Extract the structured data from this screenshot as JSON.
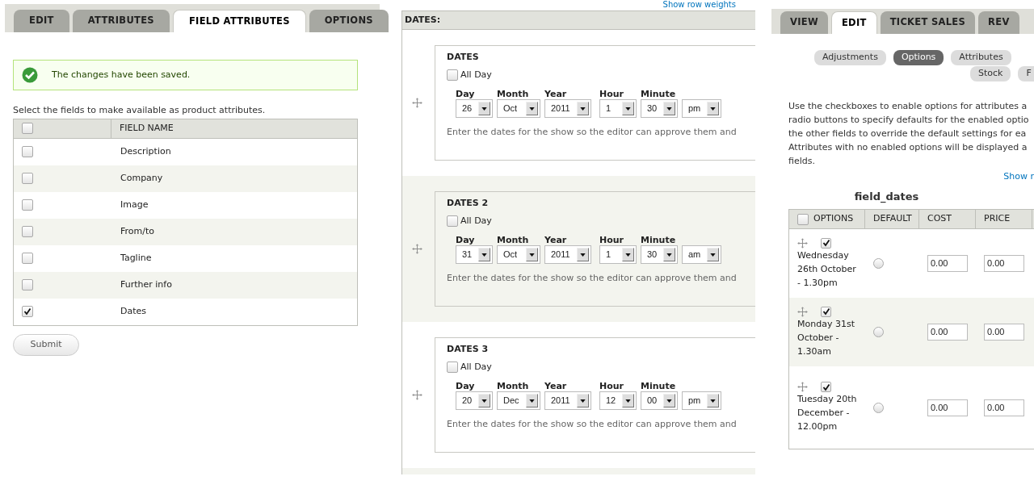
{
  "left": {
    "tabs": [
      {
        "label": "EDIT",
        "selected": false
      },
      {
        "label": "ATTRIBUTES",
        "selected": false
      },
      {
        "label": "FIELD ATTRIBUTES",
        "selected": true
      },
      {
        "label": "OPTIONS",
        "selected": false
      }
    ],
    "message": "The changes have been saved.",
    "intro": "Select the fields to make available as product attributes.",
    "table": {
      "select_all_checked": false,
      "column": "FIELD NAME",
      "rows": [
        {
          "label": "Description",
          "checked": false
        },
        {
          "label": "Company",
          "checked": false
        },
        {
          "label": "Image",
          "checked": false
        },
        {
          "label": "From/to",
          "checked": false
        },
        {
          "label": "Tagline",
          "checked": false
        },
        {
          "label": "Further info",
          "checked": false
        },
        {
          "label": "Dates",
          "checked": true
        }
      ]
    },
    "submit": "Submit"
  },
  "middle": {
    "top_link": "Show row weights",
    "heading": "DATES:",
    "groups": [
      {
        "title": "DATES",
        "all_day_label": "All Day",
        "all_day": false,
        "date_fields": [
          {
            "label": "Day",
            "value": "26"
          },
          {
            "label": "Month",
            "value": "Oct"
          },
          {
            "label": "Year",
            "value": "2011"
          }
        ],
        "time_fields": [
          {
            "label": "Hour",
            "value": "1"
          },
          {
            "label": "Minute",
            "value": "30"
          },
          {
            "value": "pm"
          }
        ],
        "description": "Enter the dates for the show so the editor can approve them and"
      },
      {
        "title": "DATES 2",
        "all_day_label": "All Day",
        "all_day": false,
        "date_fields": [
          {
            "label": "Day",
            "value": "31"
          },
          {
            "label": "Month",
            "value": "Oct"
          },
          {
            "label": "Year",
            "value": "2011"
          }
        ],
        "time_fields": [
          {
            "label": "Hour",
            "value": "1"
          },
          {
            "label": "Minute",
            "value": "30"
          },
          {
            "value": "am"
          }
        ],
        "description": "Enter the dates for the show so the editor can approve them and"
      },
      {
        "title": "DATES 3",
        "all_day_label": "All Day",
        "all_day": false,
        "date_fields": [
          {
            "label": "Day",
            "value": "20"
          },
          {
            "label": "Month",
            "value": "Dec"
          },
          {
            "label": "Year",
            "value": "2011"
          }
        ],
        "time_fields": [
          {
            "label": "Hour",
            "value": "12"
          },
          {
            "label": "Minute",
            "value": "00"
          },
          {
            "value": "pm"
          }
        ],
        "description": "Enter the dates for the show so the editor can approve them and"
      }
    ]
  },
  "right": {
    "tabs": [
      {
        "label": "VIEW",
        "selected": false
      },
      {
        "label": "EDIT",
        "selected": true
      },
      {
        "label": "TICKET SALES",
        "selected": false
      },
      {
        "label": "REV",
        "selected": false
      }
    ],
    "pills": [
      {
        "label": "Adjustments",
        "selected": false
      },
      {
        "label": "Options",
        "selected": true
      },
      {
        "label": "Attributes",
        "selected": false
      },
      {
        "label": "Stock",
        "selected": false
      },
      {
        "label": "F",
        "selected": false
      }
    ],
    "paragraph_lines": [
      "Use the checkboxes to enable options for attributes a",
      "radio buttons to specify defaults for the enabled optio",
      "the other fields to override the default settings for ea",
      "Attributes with no enabled options will be displayed a",
      "fields."
    ],
    "link": "Show r",
    "table_title": "field_dates",
    "table": {
      "select_all_checked": false,
      "columns": [
        "OPTIONS",
        "DEFAULT",
        "COST",
        "PRICE"
      ],
      "rows": [
        {
          "label": "Wednesday 26th October - 1.30pm",
          "enabled": true,
          "default": false,
          "cost": "0.00",
          "price": "0.00"
        },
        {
          "label": "Monday 31st October - 1.30am",
          "enabled": true,
          "default": false,
          "cost": "0.00",
          "price": "0.00"
        },
        {
          "label": "Tuesday 20th December - 12.00pm",
          "enabled": true,
          "default": false,
          "cost": "0.00",
          "price": "0.00"
        }
      ]
    }
  }
}
